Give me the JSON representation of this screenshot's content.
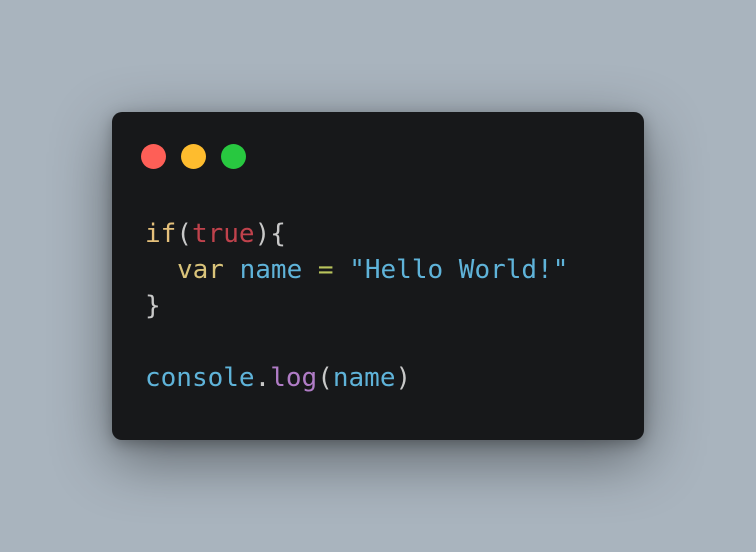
{
  "colors": {
    "background": "#a9b4be",
    "window": "#17181a",
    "dot_red": "#fe5f57",
    "dot_yellow": "#febc2e",
    "dot_green": "#28c840",
    "keyword_if": "#e5c07b",
    "punctuation": "#c8c8c8",
    "boolean": "#c0424c",
    "keyword_var": "#d9c37a",
    "identifier": "#5fb3d9",
    "operator": "#b9c45c",
    "string": "#5fb3d9",
    "method": "#b07cc6"
  },
  "code": {
    "line1": {
      "kw_if": "if",
      "paren_open": "(",
      "bool_true": "true",
      "paren_close_brace": "){"
    },
    "line2": {
      "kw_var": "var",
      "ident_name": "name",
      "op_eq": "=",
      "str_hello": "\"Hello World!\""
    },
    "line3": {
      "brace_close": "}"
    },
    "line4": {
      "blank": ""
    },
    "line5": {
      "obj_console": "console",
      "dot": ".",
      "method_log": "log",
      "paren_open": "(",
      "arg_name": "name",
      "paren_close": ")"
    }
  }
}
